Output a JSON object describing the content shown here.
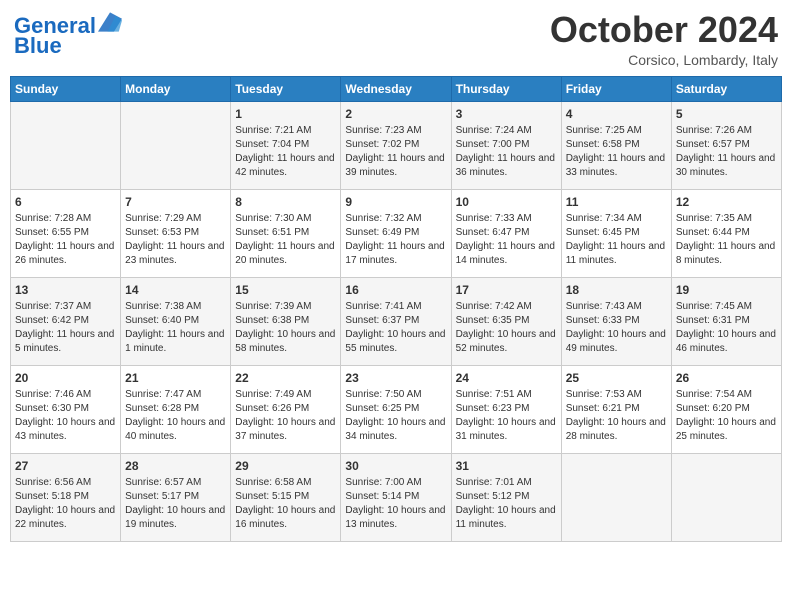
{
  "header": {
    "logo_line1": "General",
    "logo_line2": "Blue",
    "month_title": "October 2024",
    "location": "Corsico, Lombardy, Italy"
  },
  "days_of_week": [
    "Sunday",
    "Monday",
    "Tuesday",
    "Wednesday",
    "Thursday",
    "Friday",
    "Saturday"
  ],
  "weeks": [
    [
      {
        "day": "",
        "info": ""
      },
      {
        "day": "",
        "info": ""
      },
      {
        "day": "1",
        "info": "Sunrise: 7:21 AM\nSunset: 7:04 PM\nDaylight: 11 hours and 42 minutes."
      },
      {
        "day": "2",
        "info": "Sunrise: 7:23 AM\nSunset: 7:02 PM\nDaylight: 11 hours and 39 minutes."
      },
      {
        "day": "3",
        "info": "Sunrise: 7:24 AM\nSunset: 7:00 PM\nDaylight: 11 hours and 36 minutes."
      },
      {
        "day": "4",
        "info": "Sunrise: 7:25 AM\nSunset: 6:58 PM\nDaylight: 11 hours and 33 minutes."
      },
      {
        "day": "5",
        "info": "Sunrise: 7:26 AM\nSunset: 6:57 PM\nDaylight: 11 hours and 30 minutes."
      }
    ],
    [
      {
        "day": "6",
        "info": "Sunrise: 7:28 AM\nSunset: 6:55 PM\nDaylight: 11 hours and 26 minutes."
      },
      {
        "day": "7",
        "info": "Sunrise: 7:29 AM\nSunset: 6:53 PM\nDaylight: 11 hours and 23 minutes."
      },
      {
        "day": "8",
        "info": "Sunrise: 7:30 AM\nSunset: 6:51 PM\nDaylight: 11 hours and 20 minutes."
      },
      {
        "day": "9",
        "info": "Sunrise: 7:32 AM\nSunset: 6:49 PM\nDaylight: 11 hours and 17 minutes."
      },
      {
        "day": "10",
        "info": "Sunrise: 7:33 AM\nSunset: 6:47 PM\nDaylight: 11 hours and 14 minutes."
      },
      {
        "day": "11",
        "info": "Sunrise: 7:34 AM\nSunset: 6:45 PM\nDaylight: 11 hours and 11 minutes."
      },
      {
        "day": "12",
        "info": "Sunrise: 7:35 AM\nSunset: 6:44 PM\nDaylight: 11 hours and 8 minutes."
      }
    ],
    [
      {
        "day": "13",
        "info": "Sunrise: 7:37 AM\nSunset: 6:42 PM\nDaylight: 11 hours and 5 minutes."
      },
      {
        "day": "14",
        "info": "Sunrise: 7:38 AM\nSunset: 6:40 PM\nDaylight: 11 hours and 1 minute."
      },
      {
        "day": "15",
        "info": "Sunrise: 7:39 AM\nSunset: 6:38 PM\nDaylight: 10 hours and 58 minutes."
      },
      {
        "day": "16",
        "info": "Sunrise: 7:41 AM\nSunset: 6:37 PM\nDaylight: 10 hours and 55 minutes."
      },
      {
        "day": "17",
        "info": "Sunrise: 7:42 AM\nSunset: 6:35 PM\nDaylight: 10 hours and 52 minutes."
      },
      {
        "day": "18",
        "info": "Sunrise: 7:43 AM\nSunset: 6:33 PM\nDaylight: 10 hours and 49 minutes."
      },
      {
        "day": "19",
        "info": "Sunrise: 7:45 AM\nSunset: 6:31 PM\nDaylight: 10 hours and 46 minutes."
      }
    ],
    [
      {
        "day": "20",
        "info": "Sunrise: 7:46 AM\nSunset: 6:30 PM\nDaylight: 10 hours and 43 minutes."
      },
      {
        "day": "21",
        "info": "Sunrise: 7:47 AM\nSunset: 6:28 PM\nDaylight: 10 hours and 40 minutes."
      },
      {
        "day": "22",
        "info": "Sunrise: 7:49 AM\nSunset: 6:26 PM\nDaylight: 10 hours and 37 minutes."
      },
      {
        "day": "23",
        "info": "Sunrise: 7:50 AM\nSunset: 6:25 PM\nDaylight: 10 hours and 34 minutes."
      },
      {
        "day": "24",
        "info": "Sunrise: 7:51 AM\nSunset: 6:23 PM\nDaylight: 10 hours and 31 minutes."
      },
      {
        "day": "25",
        "info": "Sunrise: 7:53 AM\nSunset: 6:21 PM\nDaylight: 10 hours and 28 minutes."
      },
      {
        "day": "26",
        "info": "Sunrise: 7:54 AM\nSunset: 6:20 PM\nDaylight: 10 hours and 25 minutes."
      }
    ],
    [
      {
        "day": "27",
        "info": "Sunrise: 6:56 AM\nSunset: 5:18 PM\nDaylight: 10 hours and 22 minutes."
      },
      {
        "day": "28",
        "info": "Sunrise: 6:57 AM\nSunset: 5:17 PM\nDaylight: 10 hours and 19 minutes."
      },
      {
        "day": "29",
        "info": "Sunrise: 6:58 AM\nSunset: 5:15 PM\nDaylight: 10 hours and 16 minutes."
      },
      {
        "day": "30",
        "info": "Sunrise: 7:00 AM\nSunset: 5:14 PM\nDaylight: 10 hours and 13 minutes."
      },
      {
        "day": "31",
        "info": "Sunrise: 7:01 AM\nSunset: 5:12 PM\nDaylight: 10 hours and 11 minutes."
      },
      {
        "day": "",
        "info": ""
      },
      {
        "day": "",
        "info": ""
      }
    ]
  ]
}
